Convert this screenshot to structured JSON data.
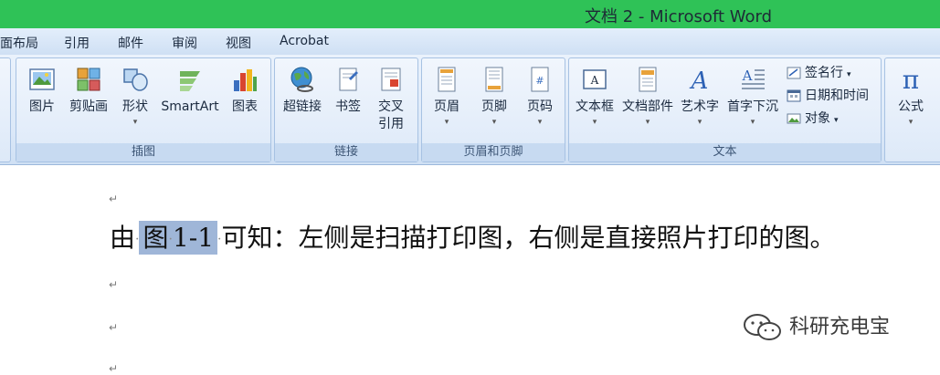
{
  "window": {
    "title": "文档 2 - Microsoft Word"
  },
  "menu": {
    "tabs": [
      "面布局",
      "引用",
      "邮件",
      "审阅",
      "视图",
      "Acrobat"
    ]
  },
  "ribbon": {
    "illustrations": {
      "group_label": "插图",
      "picture": "图片",
      "clipart": "剪贴画",
      "shapes": "形状",
      "smartart": "SmartArt",
      "chart": "图表"
    },
    "links": {
      "group_label": "链接",
      "hyperlink": "超链接",
      "bookmark": "书签",
      "crossref_line1": "交叉",
      "crossref_line2": "引用"
    },
    "header_footer": {
      "group_label": "页眉和页脚",
      "header": "页眉",
      "footer": "页脚",
      "page_number": "页码"
    },
    "text": {
      "group_label": "文本",
      "textbox": "文本框",
      "quickparts": "文档部件",
      "wordart": "艺术字",
      "dropcap": "首字下沉",
      "signature_line": "签名行",
      "datetime": "日期和时间",
      "object": "对象"
    },
    "symbols": {
      "equation": "公式"
    }
  },
  "document": {
    "para_mark": "↵",
    "line_before": "由",
    "selected_text_1": "图",
    "selected_text_2": "1-1",
    "line_after": "可知：左侧是扫描打印图，右侧是直接照片打印的图。"
  },
  "watermark": {
    "text": "科研充电宝"
  },
  "colors": {
    "titlebar": "#2fc257",
    "selection": "#9fb6d8"
  }
}
